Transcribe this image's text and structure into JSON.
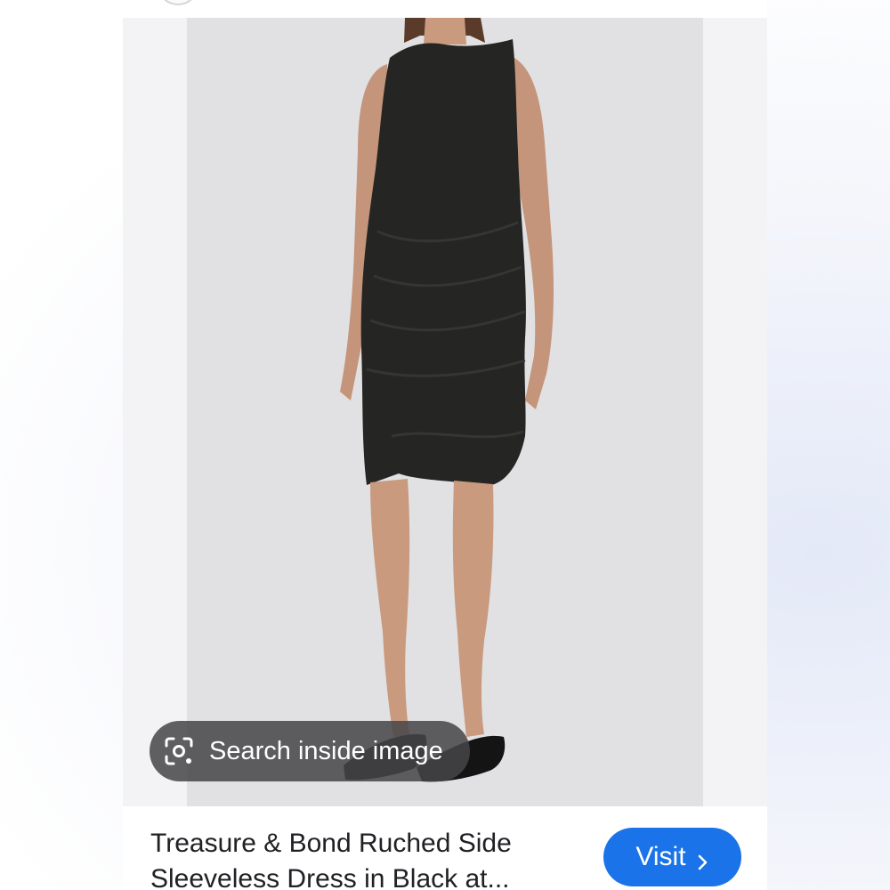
{
  "image": {
    "subject": "dress-photo",
    "colors": {
      "backdrop": "#e1e1e3",
      "dress": "#252523",
      "skin": "#c99a7e",
      "sandals": "#141414",
      "hair": "#5a3a28"
    }
  },
  "lens": {
    "label": "Search inside image",
    "icon": "lens-scan-icon"
  },
  "result": {
    "title_line1": "Treasure & Bond Ruched Side",
    "title_line2": "Sleeveless Dress in Black at..."
  },
  "visit_button": {
    "label": "Visit",
    "icon": "chevron-right-icon",
    "color": "#1a73e8"
  }
}
